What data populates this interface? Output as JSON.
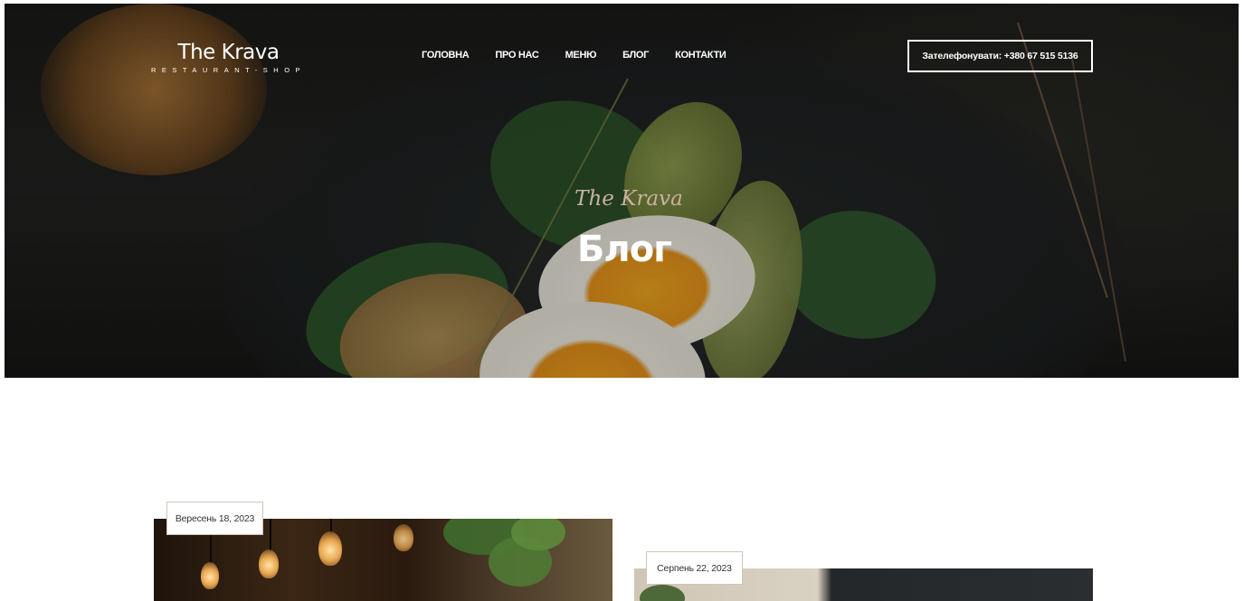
{
  "brand": {
    "name": "The Krava",
    "tagline": "RESTAURANT-SHOP"
  },
  "nav": {
    "items": [
      {
        "label": "ГОЛОВНА"
      },
      {
        "label": "ПРО НАС"
      },
      {
        "label": "МЕНЮ"
      },
      {
        "label": "БЛОГ"
      },
      {
        "label": "КОНТАКТИ"
      }
    ],
    "call_button": "Зателефонувати: +380 67 515 5136"
  },
  "hero": {
    "script_text": "The Krava",
    "title": "Блог"
  },
  "posts": [
    {
      "date": "Вересень 18, 2023"
    },
    {
      "date": "Серпень 22, 2023"
    }
  ],
  "colors": {
    "accent_script": "#c9b2a0",
    "badge_border": "#d6c3b3",
    "text_light": "#ffffff"
  }
}
